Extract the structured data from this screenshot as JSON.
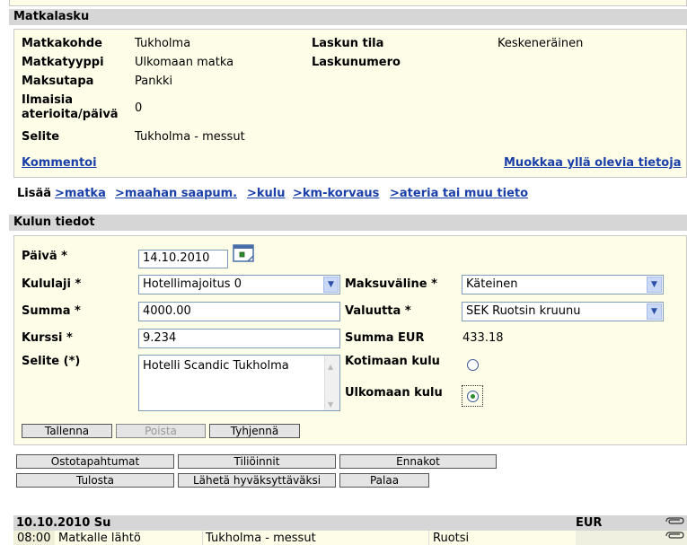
{
  "matkalasku": {
    "header": "Matkalasku",
    "rows": [
      {
        "label": "Matkakohde",
        "value": "Tukholma"
      },
      {
        "label": "Matkatyyppi",
        "value": "Ulkomaan matka"
      },
      {
        "label": "Maksutapa",
        "value": "Pankki"
      },
      {
        "label_line1": "Ilmaisia",
        "label_line2": "aterioita/päivä",
        "value": "0"
      },
      {
        "label": "Selite",
        "value": "Tukholma - messut"
      }
    ],
    "laskun_tila_label": "Laskun tila",
    "laskun_tila_value": "Keskeneräinen",
    "laskunumero_label": "Laskunumero",
    "kommentoi": "Kommentoi",
    "muokkaa": "Muokkaa yllä olevia tietoja"
  },
  "lisaa": {
    "label": "Lisää",
    "links": [
      ">matka",
      ">maahan saapum.",
      ">kulu",
      ">km-korvaus",
      ">ateria tai muu tieto"
    ]
  },
  "kulun_tiedot": {
    "header": "Kulun tiedot",
    "paiva_label": "Päivä *",
    "paiva_value": "14.10.2010",
    "kululaji_label": "Kululaji *",
    "kululaji_value": "Hotellimajoitus 0",
    "summa_label": "Summa *",
    "summa_value": "4000.00",
    "kurssi_label": "Kurssi *",
    "kurssi_value": "9.234",
    "selite_label": "Selite (*)",
    "selite_value": "Hotelli Scandic Tukholma",
    "maksuvaline_label": "Maksuväline *",
    "maksuvaline_value": "Käteinen",
    "valuutta_label": "Valuutta *",
    "valuutta_value": "SEK Ruotsin kruunu",
    "summa_eur_label": "Summa EUR",
    "summa_eur_value": "433.18",
    "kotimaan_label": "Kotimaan kulu",
    "ulkomaan_label": "Ulkomaan kulu",
    "selected_radio": "Ulkomaan kulu",
    "buttons": {
      "tallenna": "Tallenna",
      "poista": "Poista",
      "tyhjenna": "Tyhjennä"
    }
  },
  "actions": {
    "ostotapahtumat": "Ostotapahtumat",
    "tilioinnit": "Tiliöinnit",
    "ennakot": "Ennakot",
    "tulosta": "Tulosta",
    "laheta": "Lähetä hyväksyttäväksi",
    "palaa": "Palaa"
  },
  "day_table": {
    "date": "10.10.2010 Su",
    "currency": "EUR",
    "row": {
      "time": "08:00",
      "event": "Matkalle lähtö",
      "description": "Tukholma - messut",
      "country": "Ruotsi"
    }
  },
  "colors": {
    "link": "#1a3fa8",
    "panel": "#fdfde8",
    "header_bar": "#d6d6d6"
  },
  "icons": [
    "calendar-icon",
    "chevron-down-icon",
    "paperclip-icon"
  ]
}
